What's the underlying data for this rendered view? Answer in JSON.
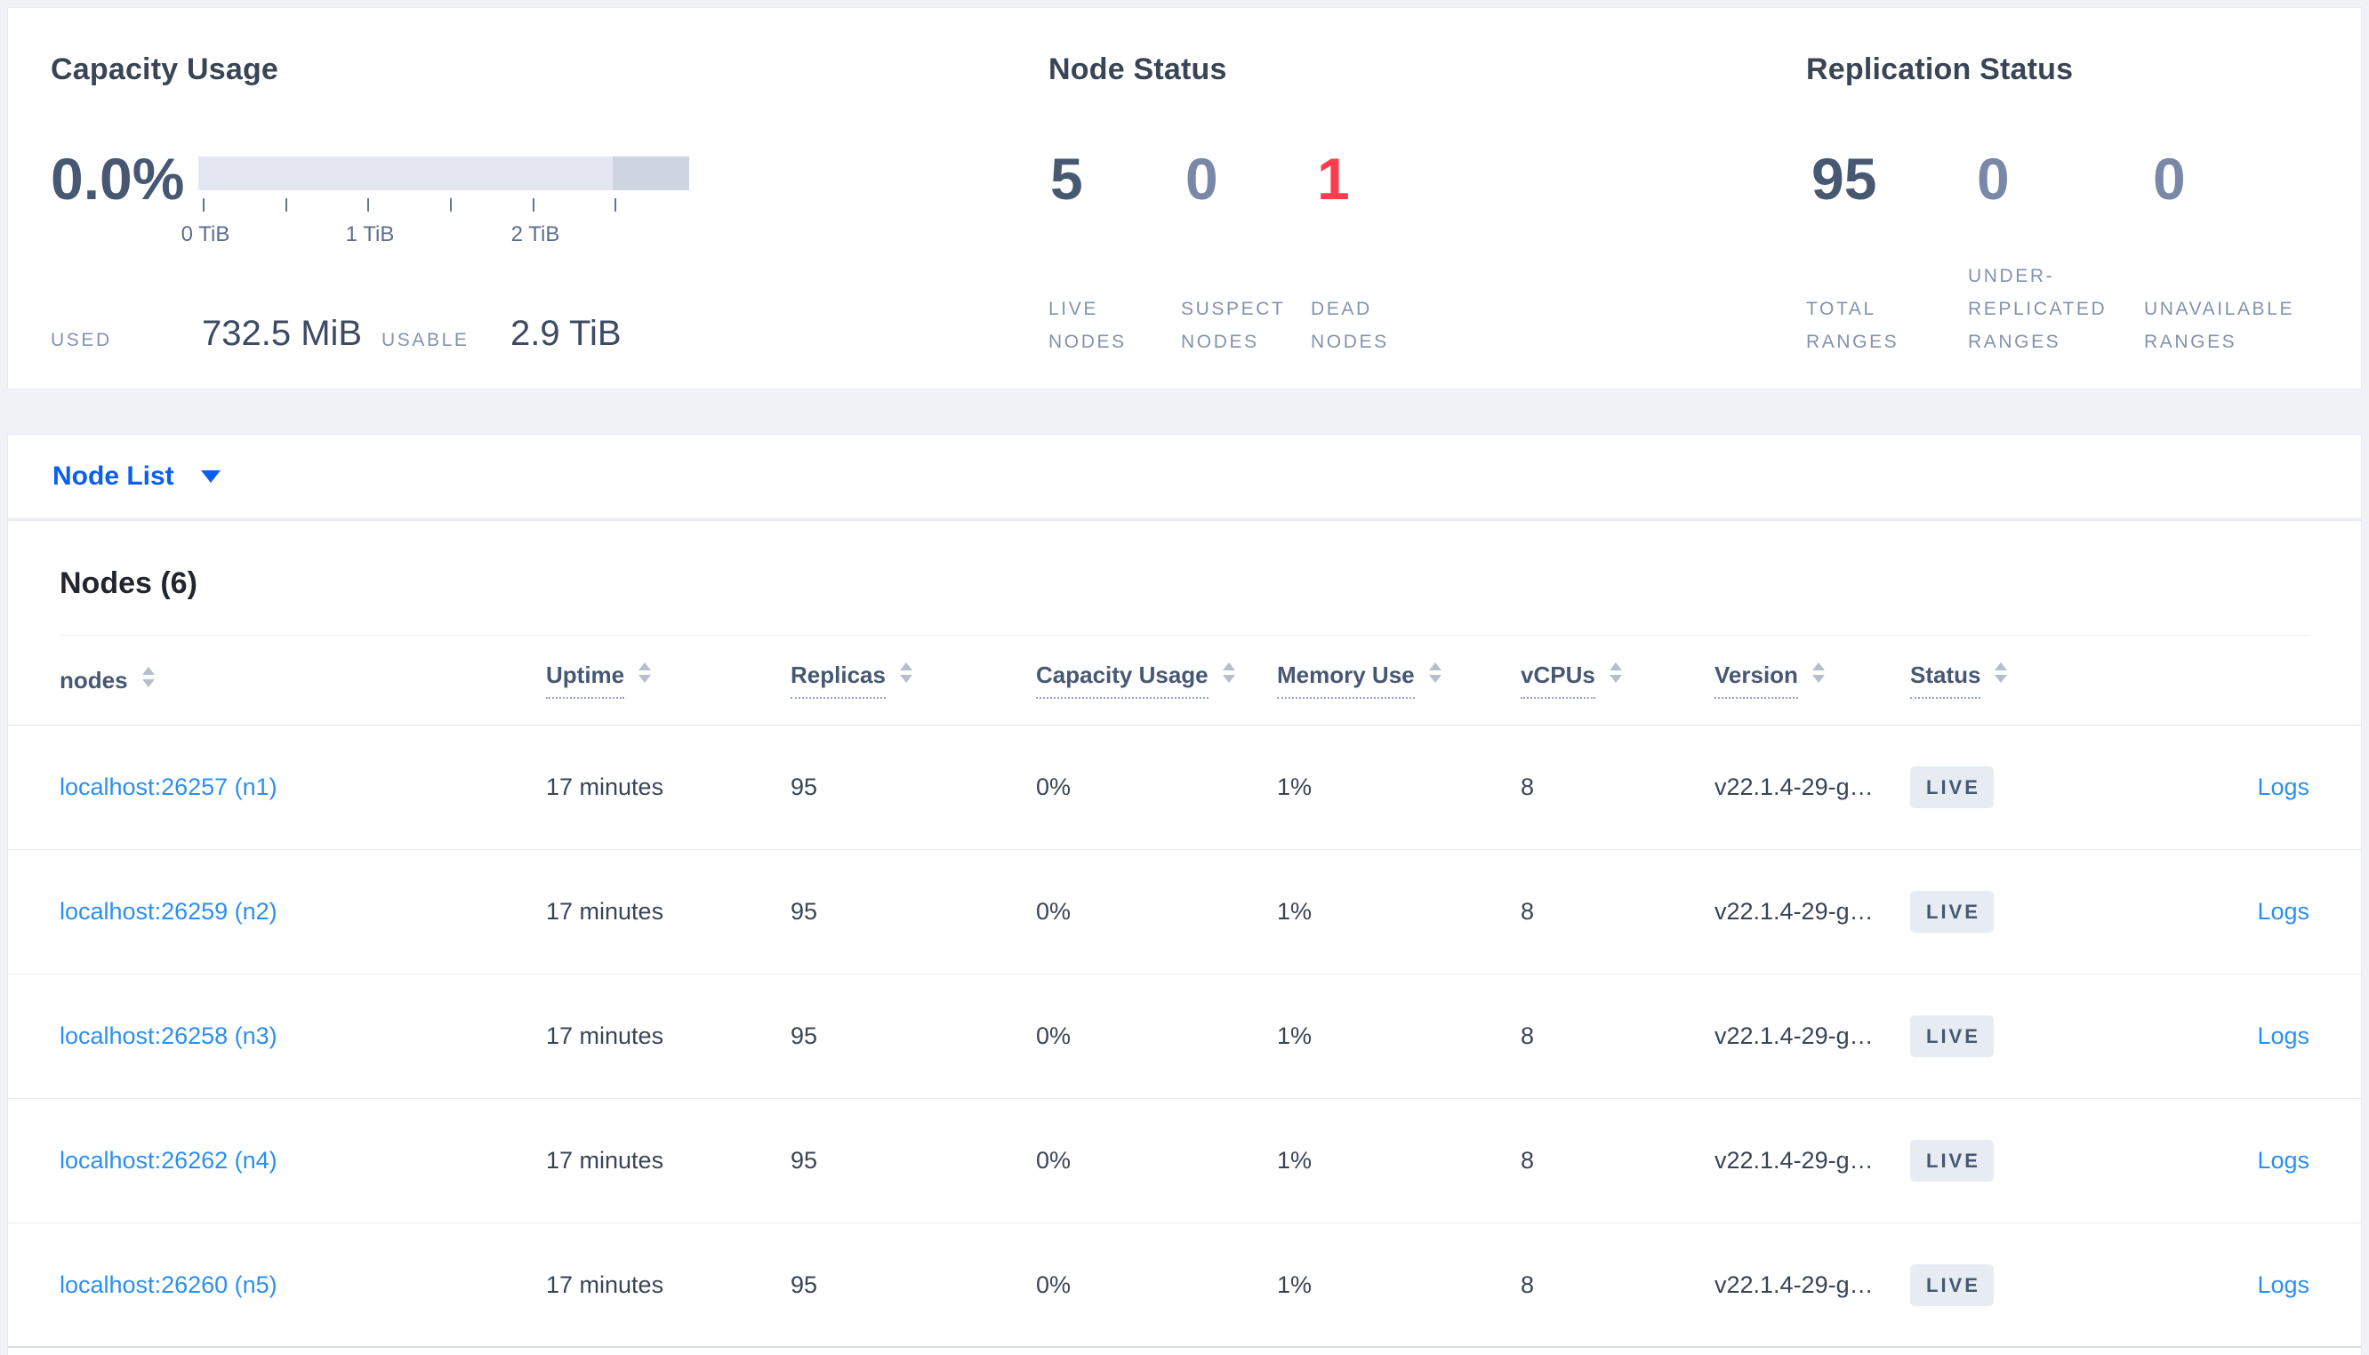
{
  "capacity_card": {
    "title": "Capacity Usage",
    "percent": "0.0%",
    "tick_labels": [
      "0 TiB",
      "1 TiB",
      "2 TiB"
    ],
    "used_label": "USED",
    "used_value": "732.5 MiB",
    "usable_label": "USABLE",
    "usable_value": "2.9 TiB"
  },
  "node_status_card": {
    "title": "Node Status",
    "stats": [
      {
        "value": "5",
        "label": "LIVE\nNODES",
        "tone": "dark"
      },
      {
        "value": "0",
        "label": "SUSPECT\nNODES",
        "tone": "muted"
      },
      {
        "value": "1",
        "label": "DEAD\nNODES",
        "tone": "red"
      }
    ]
  },
  "replication_card": {
    "title": "Replication Status",
    "stats": [
      {
        "value": "95",
        "label": "TOTAL\nRANGES",
        "tone": "dark"
      },
      {
        "value": "0",
        "label": "UNDER-\nREPLICATED\nRANGES",
        "tone": "muted"
      },
      {
        "value": "0",
        "label": "UNAVAILABLE\nRANGES",
        "tone": "muted"
      }
    ]
  },
  "node_list_bar": {
    "label": "Node List"
  },
  "nodes_table": {
    "title": "Nodes (6)",
    "columns": [
      {
        "label": "nodes",
        "underlined": false
      },
      {
        "label": "Uptime",
        "underlined": true
      },
      {
        "label": "Replicas",
        "underlined": true
      },
      {
        "label": "Capacity Usage",
        "underlined": true
      },
      {
        "label": "Memory Use",
        "underlined": true
      },
      {
        "label": "vCPUs",
        "underlined": true
      },
      {
        "label": "Version",
        "underlined": true
      },
      {
        "label": "Status",
        "underlined": true
      }
    ],
    "rows": [
      {
        "node": "localhost:26257 (n1)",
        "uptime": "17 minutes",
        "replicas": "95",
        "capacity_usage": "0%",
        "memory_use": "1%",
        "vcpus": "8",
        "version": "v22.1.4-29-g…",
        "status": "LIVE",
        "logs_label": "Logs"
      },
      {
        "node": "localhost:26259 (n2)",
        "uptime": "17 minutes",
        "replicas": "95",
        "capacity_usage": "0%",
        "memory_use": "1%",
        "vcpus": "8",
        "version": "v22.1.4-29-g…",
        "status": "LIVE",
        "logs_label": "Logs"
      },
      {
        "node": "localhost:26258 (n3)",
        "uptime": "17 minutes",
        "replicas": "95",
        "capacity_usage": "0%",
        "memory_use": "1%",
        "vcpus": "8",
        "version": "v22.1.4-29-g…",
        "status": "LIVE",
        "logs_label": "Logs"
      },
      {
        "node": "localhost:26262 (n4)",
        "uptime": "17 minutes",
        "replicas": "95",
        "capacity_usage": "0%",
        "memory_use": "1%",
        "vcpus": "8",
        "version": "v22.1.4-29-g…",
        "status": "LIVE",
        "logs_label": "Logs"
      },
      {
        "node": "localhost:26260 (n5)",
        "uptime": "17 minutes",
        "replicas": "95",
        "capacity_usage": "0%",
        "memory_use": "1%",
        "vcpus": "8",
        "version": "v22.1.4-29-g…",
        "status": "LIVE",
        "logs_label": "Logs"
      }
    ]
  },
  "colors": {
    "accent_blue": "#0b5ff0",
    "link_blue": "#2b8ff2",
    "alert_red": "#ff3b4e",
    "bar_light": "#e4e7f1",
    "bar_dark": "#cfd4e1",
    "badge_bg": "#e7ecf3"
  }
}
